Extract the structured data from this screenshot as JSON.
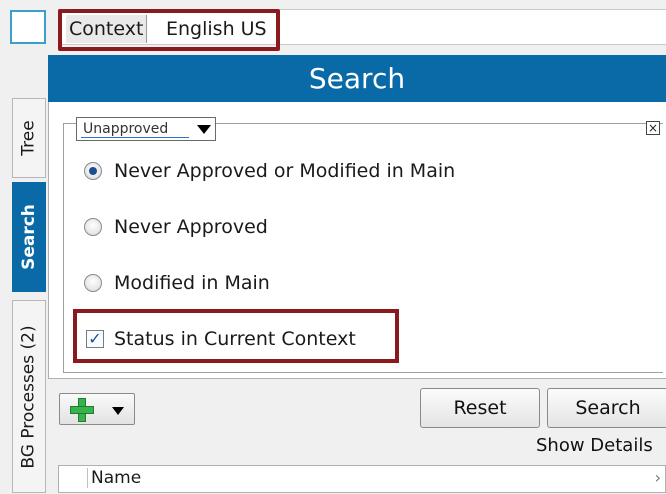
{
  "context": {
    "label": "Context",
    "value": "English US"
  },
  "tabs": {
    "tree": "Tree",
    "search": "Search",
    "bg": "BG Processes (2)"
  },
  "header": {
    "title": "Search"
  },
  "filter": {
    "dropdown_value": "Unapproved",
    "options": [
      {
        "label": "Never Approved or Modified in Main",
        "checked": true
      },
      {
        "label": "Never Approved",
        "checked": false
      },
      {
        "label": "Modified in Main",
        "checked": false
      }
    ],
    "status_checkbox": {
      "label": "Status in Current Context",
      "checked": true
    }
  },
  "toolbar": {
    "reset_label": "Reset",
    "search_label": "Search",
    "show_details": "Show Details"
  },
  "list": {
    "name_header": "Name"
  },
  "colors": {
    "accent": "#0a6aa8",
    "highlight": "#8b1a1f"
  }
}
